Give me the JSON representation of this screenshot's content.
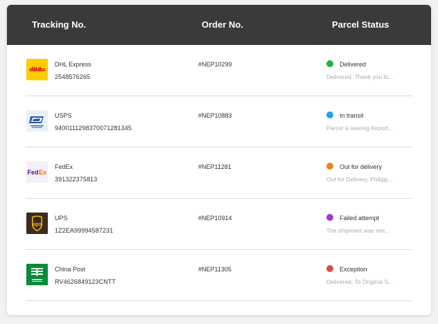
{
  "header": {
    "tracking_label": "Tracking No.",
    "order_label": "Order No.",
    "status_label": "Parcel Status"
  },
  "rows": [
    {
      "carrier": "DHL Express",
      "logo_icon": "dhl-logo-icon",
      "tracking": "2548576265",
      "order": "#NEP10299",
      "status": "Delivered",
      "status_color": "#1eb53a",
      "detail": "Delivered. Thank you fo..."
    },
    {
      "carrier": "USPS",
      "logo_icon": "usps-logo-icon",
      "tracking": "9400111298370071281345",
      "order": "#NEP10883",
      "status": "In transit",
      "status_color": "#1aa7e0",
      "detail": "Parcel is leaving Airport..."
    },
    {
      "carrier": "FedEx",
      "logo_icon": "fedex-logo-icon",
      "tracking": "391322375813",
      "order": "#NEP11281",
      "status": "Out for delivery",
      "status_color": "#e5841f",
      "detail": "Out for Delivery, Philipp..."
    },
    {
      "carrier": "UPS",
      "logo_icon": "ups-logo-icon",
      "tracking": "1Z2EA99994587231",
      "order": "#NEP10914",
      "status": "Failed attempt",
      "status_color": "#a03cc4",
      "detail": "The shipment was mis..."
    },
    {
      "carrier": "China Post",
      "logo_icon": "china-post-logo-icon",
      "tracking": "RV4626849123CNTT",
      "order": "#NEP11305",
      "status": "Exception",
      "status_color": "#e04848",
      "detail": "Delivered, To Original S..."
    }
  ]
}
